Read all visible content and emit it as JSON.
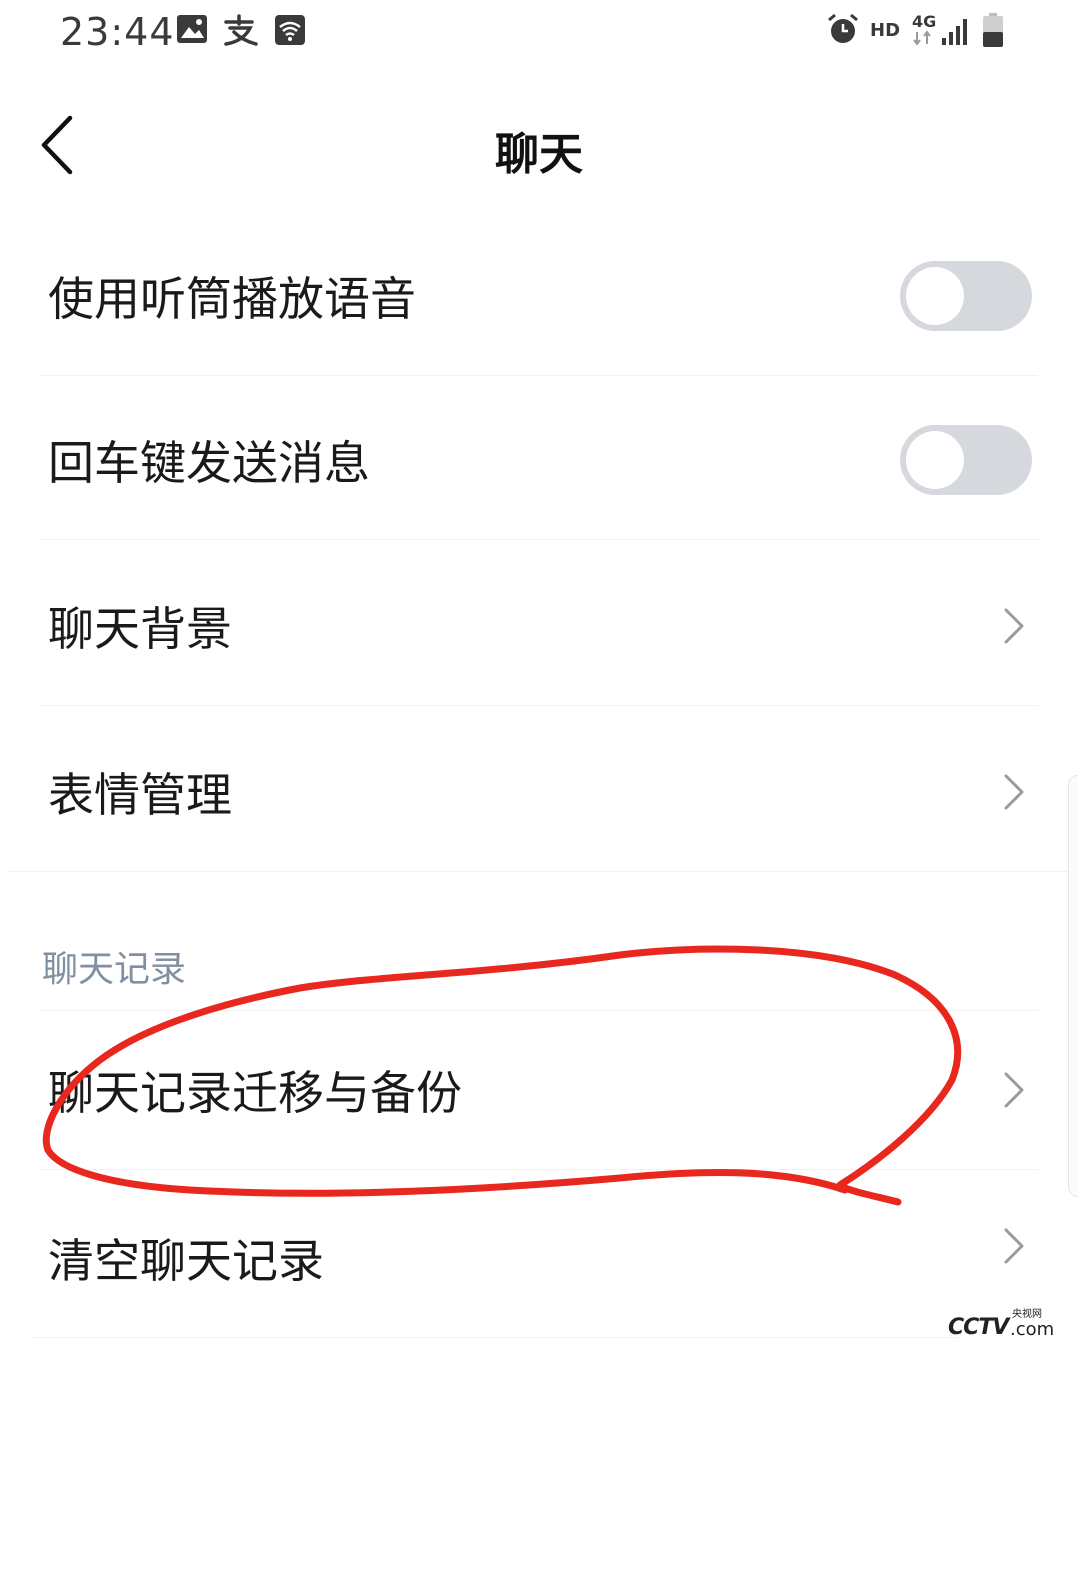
{
  "status_bar": {
    "time": "23:44",
    "network_hd": "HD",
    "network_type": "4G",
    "icons": [
      "image-icon",
      "alipay-icon",
      "wifi-icon",
      "alarm-icon",
      "signal-icon",
      "battery-icon"
    ]
  },
  "header": {
    "title": "聊天",
    "back_icon": "chevron-left-icon"
  },
  "settings": {
    "earpiece": {
      "label": "使用听筒播放语音",
      "enabled": false
    },
    "enter_send": {
      "label": "回车键发送消息",
      "enabled": false
    },
    "background": {
      "label": "聊天背景"
    },
    "stickers": {
      "label": "表情管理"
    }
  },
  "history_section": {
    "title": "聊天记录",
    "migrate": {
      "label": "聊天记录迁移与备份"
    },
    "clear": {
      "label": "清空聊天记录"
    }
  },
  "watermark": {
    "brand": "CCTV",
    "sub": "央视网",
    "domain": ".com"
  },
  "colors": {
    "toggle_off": "#d5d9dd",
    "annotation_red": "#e8281e",
    "section_title": "#8090a0"
  }
}
